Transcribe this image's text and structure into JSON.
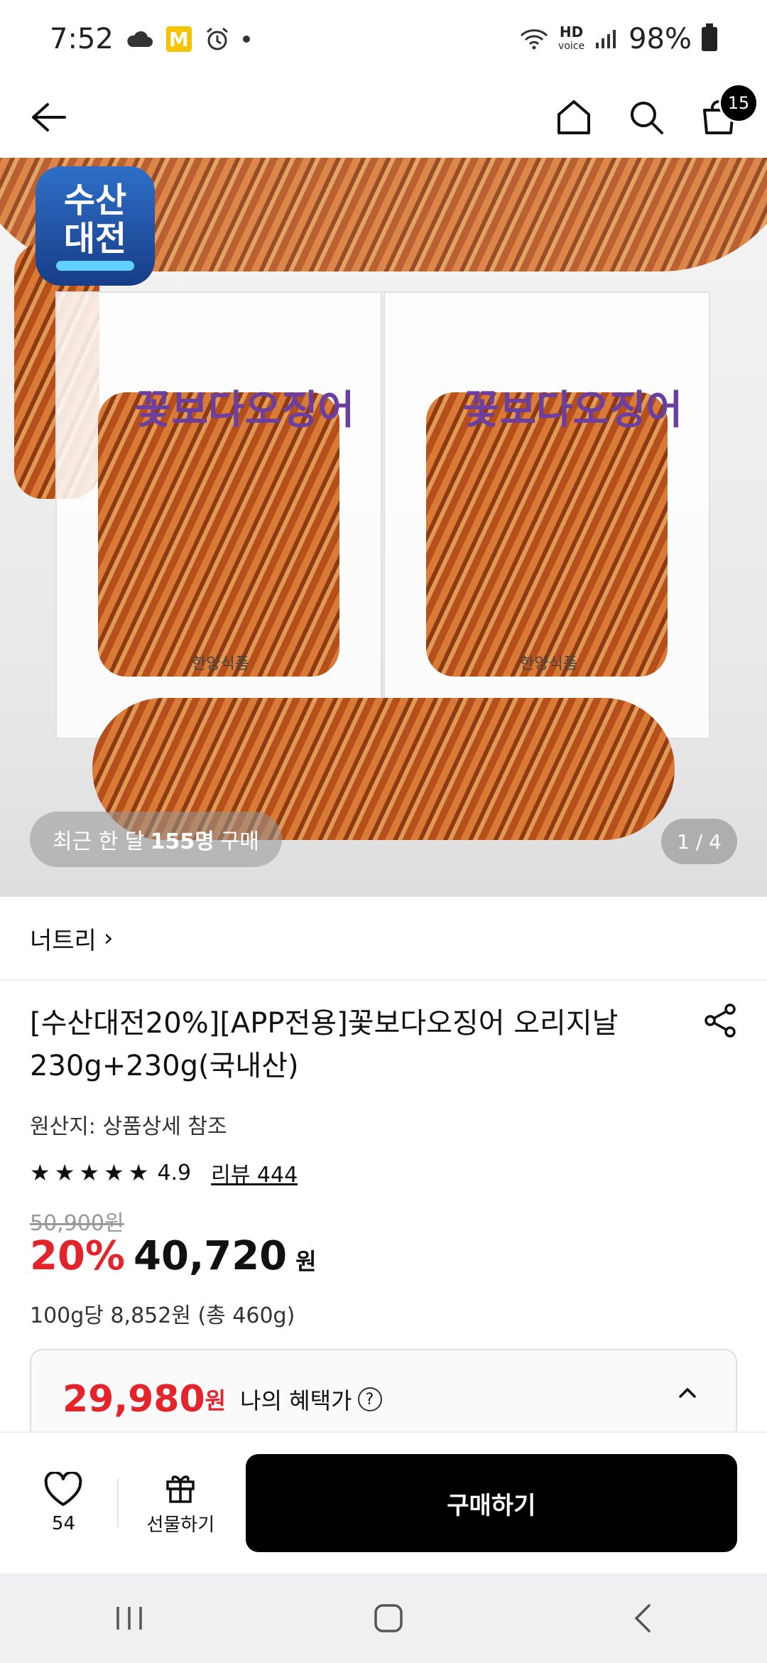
{
  "status_bar": {
    "time": "7:52",
    "m_badge": "M",
    "hd_top": "HD",
    "hd_bottom": "voice",
    "battery": "98%"
  },
  "nav": {
    "cart_count": "15"
  },
  "hero": {
    "logo_line1": "수산",
    "logo_line2": "대전",
    "bag_brand": "꽃보다오징어",
    "bag_maker": "한양식품",
    "purchase_prefix": "최근 한 달",
    "purchase_count": "155명",
    "purchase_suffix": "구매",
    "page_indicator": "1 / 4"
  },
  "brand": {
    "name": "너트리",
    "chevron": "›"
  },
  "product": {
    "title": "[수산대전20%][APP전용]꽃보다오징어 오리지날 230g+230g(국내산)",
    "origin": "원산지: 상품상세 참조",
    "rating": "4.9",
    "review_link": "리뷰 444",
    "original_price": "50,900원",
    "discount": "20%",
    "price": "40,720",
    "won": "원",
    "unit_price": "100g당 8,852원 (총 460g)"
  },
  "benefit": {
    "price": "29,980",
    "won": "원",
    "label": "나의 혜택가",
    "help": "?"
  },
  "bottom": {
    "wish_count": "54",
    "gift_label": "선물하기",
    "buy_label": "구매하기"
  },
  "colors": {
    "accent_red": "#e3242b",
    "buy_button": "#000000"
  }
}
